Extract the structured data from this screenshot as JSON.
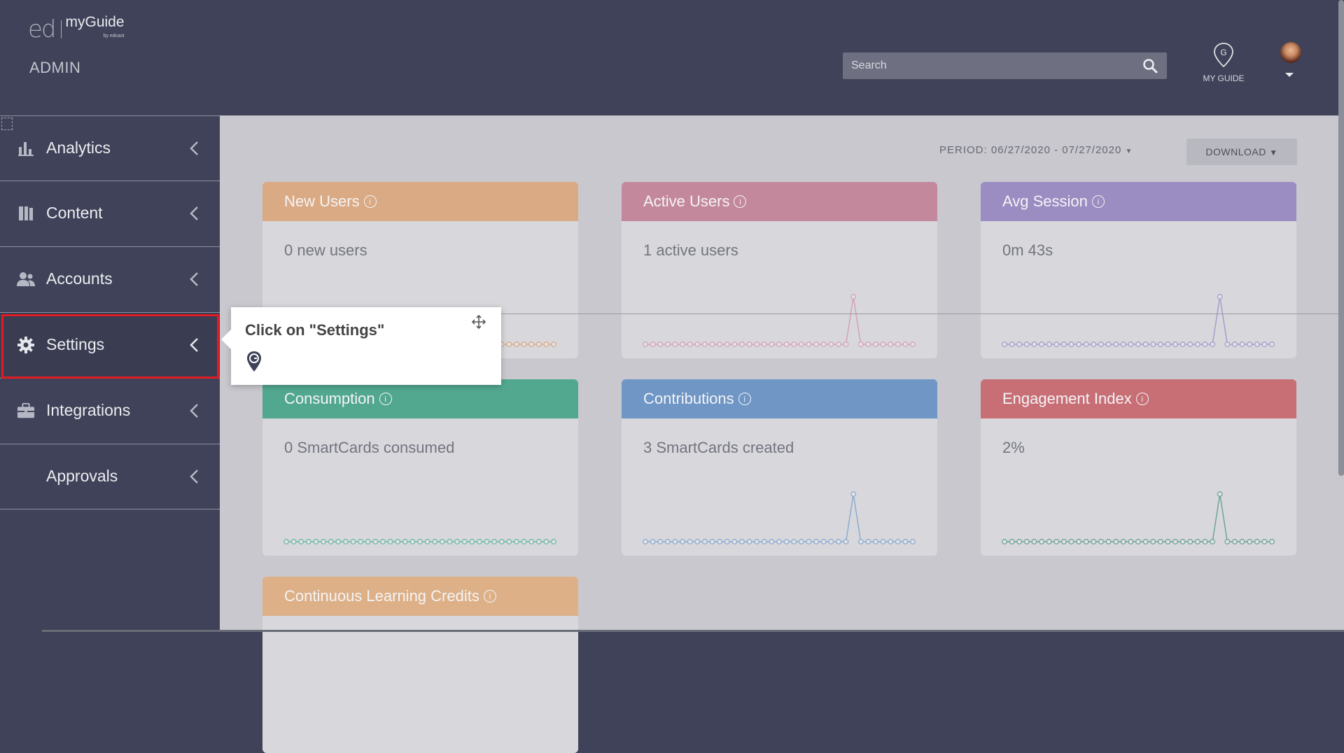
{
  "header": {
    "logo_ed": "ed",
    "logo_myguide": "myGuide",
    "logo_by": "by edcast",
    "admin_label": "ADMIN",
    "search_placeholder": "Search",
    "myguide_label": "MY GUIDE",
    "myguide_glyph": "G"
  },
  "sidebar": {
    "items": [
      {
        "label": "Analytics",
        "icon": "bar-chart-icon"
      },
      {
        "label": "Content",
        "icon": "book-icon"
      },
      {
        "label": "Accounts",
        "icon": "users-icon"
      },
      {
        "label": "Settings",
        "icon": "gear-icon",
        "active": true
      },
      {
        "label": "Integrations",
        "icon": "briefcase-icon"
      },
      {
        "label": "Approvals",
        "icon": ""
      }
    ]
  },
  "main": {
    "period_label": "PERIOD: 06/27/2020 - 07/27/2020",
    "download_label": "DOWNLOAD",
    "cards": [
      {
        "title": "New Users",
        "value": "0 new users",
        "color": "#d9aa84",
        "line": "#d9aa84",
        "spark": [
          0,
          0,
          0,
          0,
          0,
          0,
          0,
          0,
          0,
          0,
          0,
          0,
          0,
          0,
          0,
          0,
          0,
          0,
          0,
          0,
          0,
          0,
          0,
          0,
          0,
          0,
          0,
          0,
          0,
          0,
          0,
          0,
          0,
          0,
          0,
          0,
          0
        ]
      },
      {
        "title": "Active Users",
        "value": "1 active users",
        "color": "#c4889c",
        "line": "#d4a2b2",
        "spark": [
          0,
          0,
          0,
          0,
          0,
          0,
          0,
          0,
          0,
          0,
          0,
          0,
          0,
          0,
          0,
          0,
          0,
          0,
          0,
          0,
          0,
          0,
          0,
          0,
          0,
          0,
          0,
          0,
          1,
          0,
          0,
          0,
          0,
          0,
          0,
          0,
          0
        ]
      },
      {
        "title": "Avg Session",
        "value": "0m 43s",
        "color": "#9b8cc2",
        "line": "#a79ccb",
        "spark": [
          0,
          0,
          0,
          0,
          0,
          0,
          0,
          0,
          0,
          0,
          0,
          0,
          0,
          0,
          0,
          0,
          0,
          0,
          0,
          0,
          0,
          0,
          0,
          0,
          0,
          0,
          0,
          0,
          0,
          1,
          0,
          0,
          0,
          0,
          0,
          0,
          0
        ]
      },
      {
        "title": "Consumption",
        "value": "0 SmartCards consumed",
        "color": "#52a88f",
        "line": "#6fb8a1",
        "spark": [
          0,
          0,
          0,
          0,
          0,
          0,
          0,
          0,
          0,
          0,
          0,
          0,
          0,
          0,
          0,
          0,
          0,
          0,
          0,
          0,
          0,
          0,
          0,
          0,
          0,
          0,
          0,
          0,
          0,
          0,
          0,
          0,
          0,
          0,
          0,
          0,
          0
        ]
      },
      {
        "title": "Contributions",
        "value": "3 SmartCards created",
        "color": "#6f96c5",
        "line": "#8cabd0",
        "spark": [
          0,
          0,
          0,
          0,
          0,
          0,
          0,
          0,
          0,
          0,
          0,
          0,
          0,
          0,
          0,
          0,
          0,
          0,
          0,
          0,
          0,
          0,
          0,
          0,
          0,
          0,
          0,
          0,
          1,
          0,
          0,
          0,
          0,
          0,
          0,
          0,
          0
        ]
      },
      {
        "title": "Engagement Index",
        "value": "2%",
        "color": "#c86f76",
        "line": "#6fa397",
        "spark": [
          0,
          0,
          0,
          0,
          0,
          0,
          0,
          0,
          0,
          0,
          0,
          0,
          0,
          0,
          0,
          0,
          0,
          0,
          0,
          0,
          0,
          0,
          0,
          0,
          0,
          0,
          0,
          0,
          0,
          1,
          0,
          0,
          0,
          0,
          0,
          0,
          0
        ]
      },
      {
        "title": "Continuous Learning Credits",
        "value": "",
        "color": "#ddb087",
        "line": "#ddb087",
        "spark": []
      }
    ]
  },
  "tooltip": {
    "text": "Click on \"Settings\""
  }
}
